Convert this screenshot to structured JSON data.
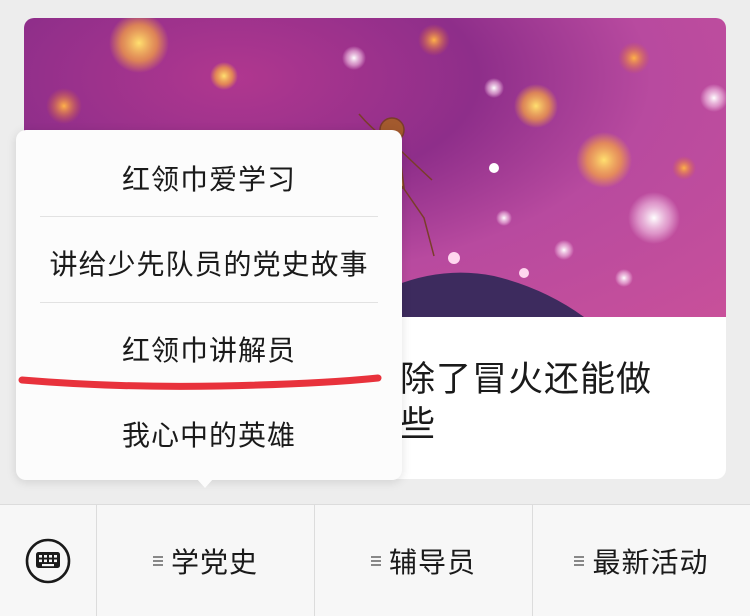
{
  "article": {
    "title_line1": "除了冒火还能做",
    "title_line2": "些"
  },
  "popup_menu": {
    "items": [
      {
        "label": "红领巾爱学习"
      },
      {
        "label": "讲给少先队员的党史故事"
      },
      {
        "label": "红领巾讲解员"
      },
      {
        "label": "我心中的英雄"
      }
    ],
    "highlighted_item": "红领巾讲解员",
    "underline_color": "#e8323c"
  },
  "bottom_bar": {
    "keyboard_icon": "keyboard-icon",
    "menu_icon": "menu-lines-icon",
    "tabs": [
      {
        "label": "学党史"
      },
      {
        "label": "辅导员"
      },
      {
        "label": "最新活动"
      }
    ]
  },
  "colors": {
    "background": "#ededed",
    "cover_base": "#a3368f",
    "bar_background": "#f7f7f7"
  }
}
